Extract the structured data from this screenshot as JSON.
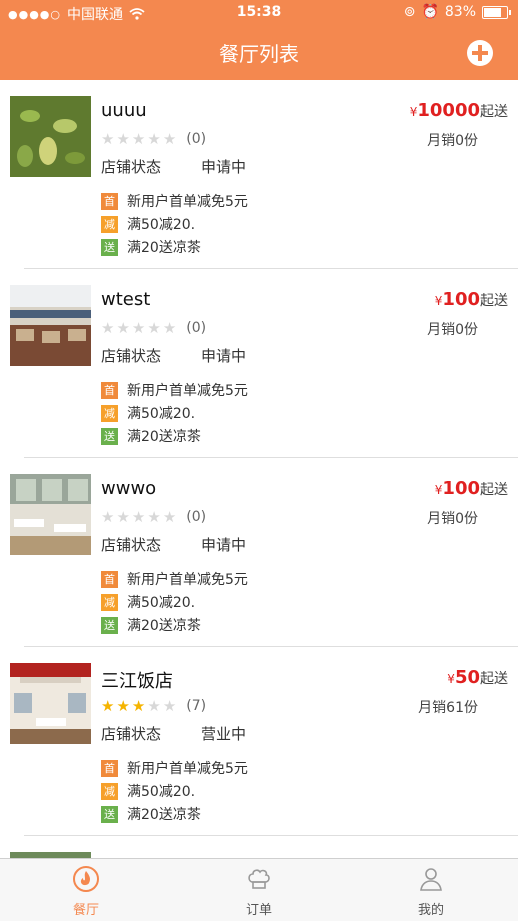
{
  "status_bar": {
    "carrier": "中国联通",
    "time": "15:38",
    "battery": "83%"
  },
  "nav": {
    "title": "餐厅列表"
  },
  "restaurants": [
    {
      "name": "uuuu",
      "price_symbol": "¥",
      "price": "10000",
      "price_suffix": "起送",
      "rating_count": "(0)",
      "rating": 0,
      "monthly_sales": "月销0份",
      "status_label": "店铺状态",
      "status_value": "申请中",
      "promos": [
        {
          "tag": "首",
          "text": "新用户首单减免5元"
        },
        {
          "tag": "减",
          "text": "满50减20."
        },
        {
          "tag": "送",
          "text": "满20送凉茶"
        }
      ]
    },
    {
      "name": "wtest",
      "price_symbol": "¥",
      "price": "100",
      "price_suffix": "起送",
      "rating_count": "(0)",
      "rating": 0,
      "monthly_sales": "月销0份",
      "status_label": "店铺状态",
      "status_value": "申请中",
      "promos": [
        {
          "tag": "首",
          "text": "新用户首单减免5元"
        },
        {
          "tag": "减",
          "text": "满50减20."
        },
        {
          "tag": "送",
          "text": "满20送凉茶"
        }
      ]
    },
    {
      "name": "wwwo",
      "price_symbol": "¥",
      "price": "100",
      "price_suffix": "起送",
      "rating_count": "(0)",
      "rating": 0,
      "monthly_sales": "月销0份",
      "status_label": "店铺状态",
      "status_value": "申请中",
      "promos": [
        {
          "tag": "首",
          "text": "新用户首单减免5元"
        },
        {
          "tag": "减",
          "text": "满50减20."
        },
        {
          "tag": "送",
          "text": "满20送凉茶"
        }
      ]
    },
    {
      "name": "三江饭店",
      "price_symbol": "¥",
      "price": "50",
      "price_suffix": "起送",
      "rating_count": "(7)",
      "rating": 3,
      "monthly_sales": "月销61份",
      "status_label": "店铺状态",
      "status_value": "营业中",
      "promos": [
        {
          "tag": "首",
          "text": "新用户首单减免5元"
        },
        {
          "tag": "减",
          "text": "满50减20."
        },
        {
          "tag": "送",
          "text": "满20送凉茶"
        }
      ]
    }
  ],
  "tabbar": {
    "tab1": "餐厅",
    "tab2": "订单",
    "tab3": "我的"
  },
  "colors": {
    "accent": "#f4884f",
    "price": "#e02020",
    "star_on": "#f5b400"
  }
}
